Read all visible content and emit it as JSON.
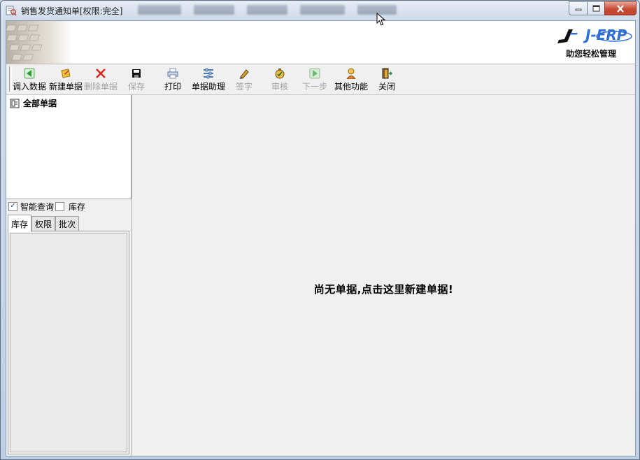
{
  "window": {
    "title": "销售发货通知单[权限:完全]"
  },
  "titlebar_icons": [
    "minimize-icon",
    "maximize-icon",
    "close-icon"
  ],
  "banner": {
    "logo_text": "J-ERP",
    "slogan": "助您轻松管理"
  },
  "toolbar": {
    "items": [
      {
        "label": "调入数据",
        "icon": "import-icon",
        "enabled": true
      },
      {
        "label": "新建单据",
        "icon": "new-document-icon",
        "enabled": true
      },
      {
        "label": "删除单据",
        "icon": "delete-icon",
        "enabled": false
      },
      {
        "label": "保存",
        "icon": "save-icon",
        "enabled": false
      },
      {
        "label": "打印",
        "icon": "print-icon",
        "enabled": true
      },
      {
        "label": "单据助理",
        "icon": "assistant-icon",
        "enabled": true
      },
      {
        "label": "签字",
        "icon": "sign-icon",
        "enabled": false
      },
      {
        "label": "审核",
        "icon": "audit-icon",
        "enabled": false
      },
      {
        "label": "下一步",
        "icon": "next-step-icon",
        "enabled": false
      },
      {
        "label": "其他功能",
        "icon": "other-functions-icon",
        "enabled": true
      },
      {
        "label": "关闭",
        "icon": "exit-icon",
        "enabled": true
      }
    ]
  },
  "tree": {
    "root_label": "全部单据"
  },
  "options": {
    "smart_query": {
      "label": "智能查询",
      "checked": true
    },
    "stock": {
      "label": "库存",
      "checked": false
    }
  },
  "tabs": [
    {
      "label": "库存",
      "active": true
    },
    {
      "label": "权限",
      "active": false
    },
    {
      "label": "批次",
      "active": false
    }
  ],
  "main": {
    "empty_message": "尚无单据,点击这里新建单据!"
  },
  "colors": {
    "title_bar": "#cfdbea",
    "close_button": "#c74a34",
    "logo_blue": "#2f6fd6",
    "panel_bg": "#f0f0f0"
  }
}
